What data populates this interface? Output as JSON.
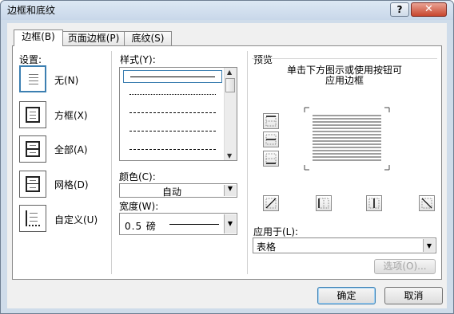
{
  "window": {
    "title": "边框和底纹",
    "help_label": "?",
    "close_label": "✕"
  },
  "tabs": [
    {
      "label": "边框(B)",
      "active": true
    },
    {
      "label": "页面边框(P)",
      "active": false
    },
    {
      "label": "底纹(S)",
      "active": false
    }
  ],
  "setting": {
    "label": "设置:",
    "options": [
      {
        "label": "无(N)",
        "icon": "none-setting-icon",
        "selected": true
      },
      {
        "label": "方框(X)",
        "icon": "box-setting-icon"
      },
      {
        "label": "全部(A)",
        "icon": "all-setting-icon"
      },
      {
        "label": "网格(D)",
        "icon": "grid-setting-icon"
      },
      {
        "label": "自定义(U)",
        "icon": "custom-setting-icon"
      }
    ]
  },
  "style": {
    "label": "样式(Y):"
  },
  "color": {
    "label": "颜色(C):",
    "value": "自动"
  },
  "width": {
    "label": "宽度(W):",
    "value": "0.5 磅"
  },
  "preview": {
    "label": "预览",
    "instructions": [
      "单击下方图示或使用按钮可",
      "应用边框"
    ]
  },
  "apply_to": {
    "label": "应用于(L):",
    "value": "表格"
  },
  "buttons": {
    "options": "选项(O)...",
    "ok": "确定",
    "cancel": "取消"
  }
}
